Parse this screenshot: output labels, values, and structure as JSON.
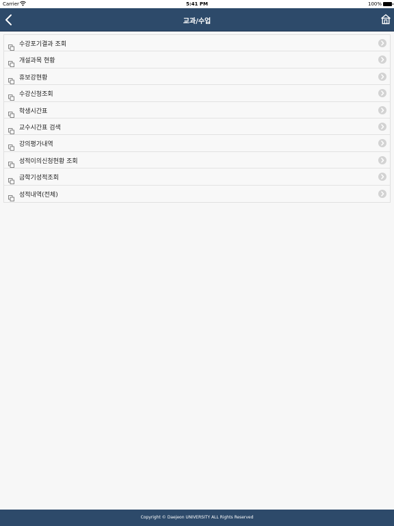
{
  "status_bar": {
    "carrier": "Carrier",
    "time": "5:41 PM",
    "battery": "100%"
  },
  "nav": {
    "title": "교과/수업",
    "back_icon": "chevron-left-icon",
    "home_icon": "home-icon"
  },
  "menu": {
    "items": [
      {
        "label": "수강포기결과 조회"
      },
      {
        "label": "개설과목 현황"
      },
      {
        "label": "휴보강현황"
      },
      {
        "label": "수강신청조회"
      },
      {
        "label": "학생시간표"
      },
      {
        "label": "교수시간표 검색"
      },
      {
        "label": "강의평가내역"
      },
      {
        "label": "성적이의신청현황 조회"
      },
      {
        "label": "금학기성적조회"
      },
      {
        "label": "성적내역(전체)"
      }
    ]
  },
  "footer": {
    "copyright": "Copyright © Daejeon UNIVERSITY ALL Rights Reserved"
  },
  "colors": {
    "header": "#2d4a6a",
    "footer": "#2d4a6a",
    "background": "#f7f7f7"
  }
}
